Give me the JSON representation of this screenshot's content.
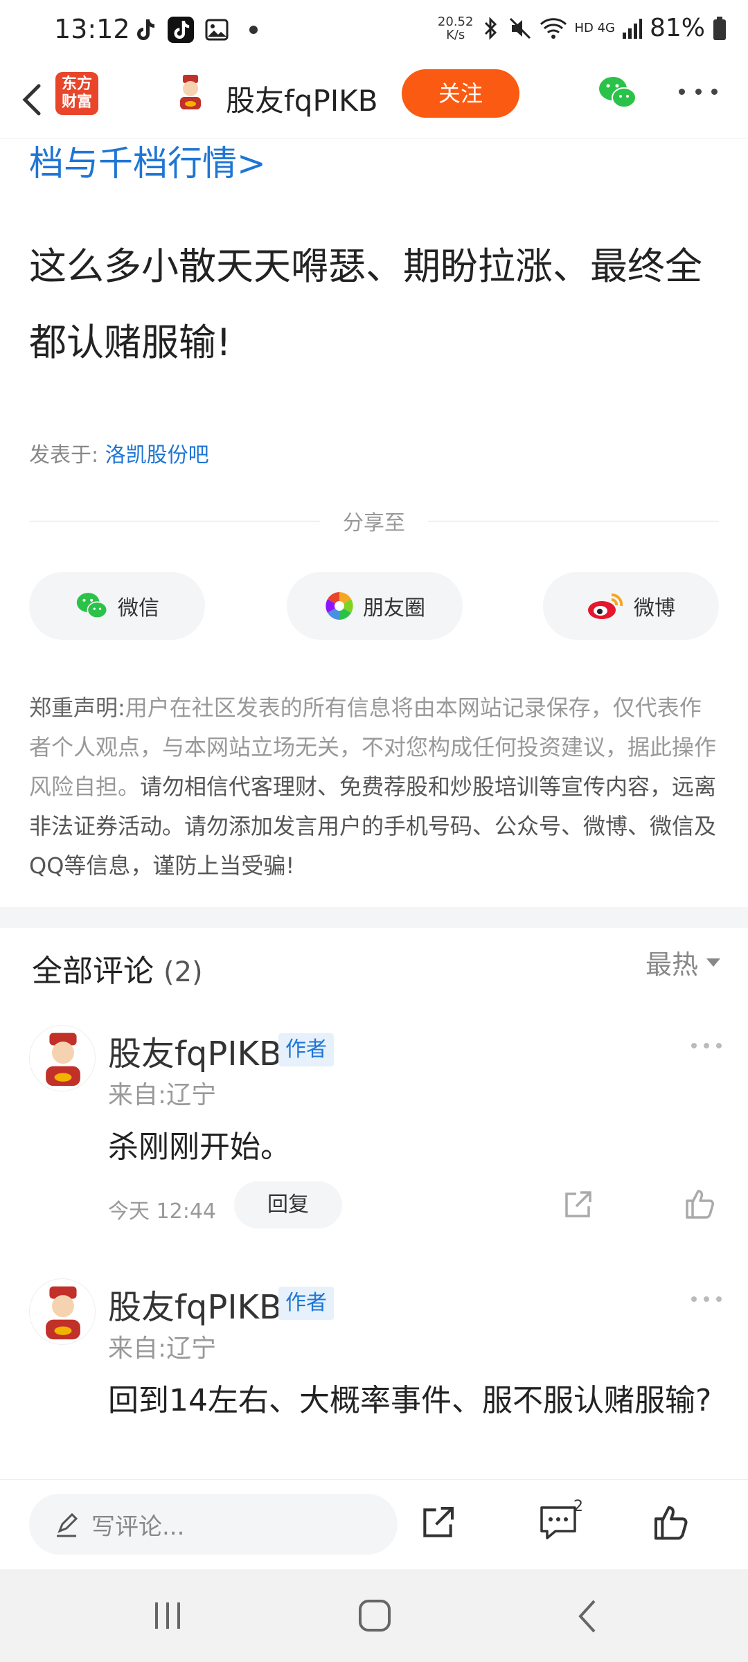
{
  "status_bar": {
    "time": "13:12",
    "net_speed_value": "20.52",
    "net_speed_unit": "K/s",
    "network": "HD 4G",
    "battery": "81%",
    "icons": [
      "tiktok-icon",
      "tiktok-app-icon",
      "gallery-icon",
      "dot",
      "bluetooth-icon",
      "mute-icon",
      "wifi-icon",
      "signal-icon",
      "battery-icon"
    ]
  },
  "nav": {
    "app_logo_line1": "东方",
    "app_logo_line2": "财富",
    "username": "股友fqPIKB",
    "follow_label": "关注"
  },
  "article": {
    "top_link": "档与千档行情>",
    "body": "这么多小散天天嘚瑟、期盼拉涨、最终全都认赌服输!",
    "posted_prefix": "发表于: ",
    "posted_bar": "洛凯股份吧"
  },
  "share": {
    "label": "分享至",
    "buttons": [
      {
        "label": "微信",
        "icon": "wechat-icon"
      },
      {
        "label": "朋友圈",
        "icon": "moments-icon"
      },
      {
        "label": "微博",
        "icon": "weibo-icon"
      }
    ]
  },
  "disclaimer": {
    "heading": "郑重声明:",
    "part1": "用户在社区发表的所有信息将由本网站记录保存，仅代表作者个人观点，与本网站立场无关，不对您构成任何投资建议，据此操作风险自担。",
    "part2": "请勿相信代客理财、免费荐股和炒股培训等宣传内容，远离非法证券活动。请勿添加发言用户的手机号码、公众号、微博、微信及QQ等信息，谨防上当受骗!"
  },
  "comments": {
    "title": "全部评论",
    "count": "(2)",
    "sort_label": "最热",
    "items": [
      {
        "name": "股友fqPIKB",
        "badge": "作者",
        "location": "来自:辽宁",
        "text": "杀刚刚开始。",
        "time": "今天 12:44",
        "reply_label": "回复"
      },
      {
        "name": "股友fqPIKB",
        "badge": "作者",
        "location": "来自:辽宁",
        "text": "回到14左右、大概率事件、服不服认赌服输?"
      }
    ]
  },
  "bottom_bar": {
    "placeholder": "写评论...",
    "comment_count": "2"
  }
}
